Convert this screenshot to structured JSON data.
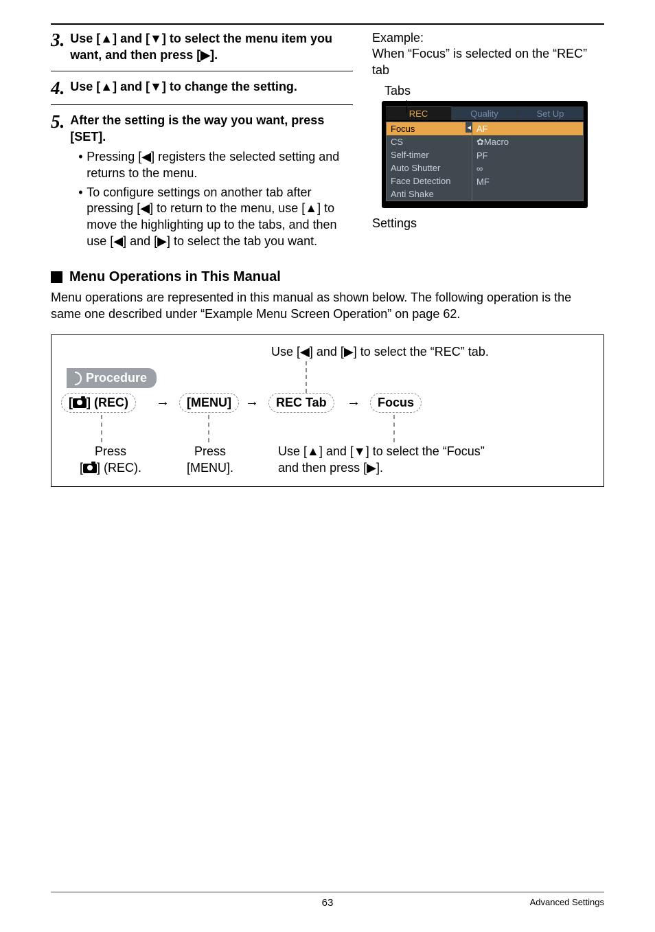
{
  "steps": {
    "s3": {
      "num": "3.",
      "text_a": "Use [",
      "text_b": "] and [",
      "text_c": "] to select the menu item you want, and then press [",
      "text_d": "]."
    },
    "s4": {
      "num": "4.",
      "text_a": "Use [",
      "text_b": "] and [",
      "text_c": "] to change the setting."
    },
    "s5": {
      "num": "5.",
      "heading": "After the setting is the way you want, press [SET].",
      "b1a": "Pressing [",
      "b1b": "] registers the selected setting and returns to the menu.",
      "b2a": "To configure settings on another tab after pressing [",
      "b2b": "] to return to the menu, use [",
      "b2c": "] to move the highlighting up to the tabs, and then use [",
      "b2d": "] and [",
      "b2e": "] to select the tab you want."
    }
  },
  "example": {
    "line1": "Example:",
    "line2": "When “Focus” is selected on the “REC” tab",
    "tabs_label": "Tabs",
    "settings_label": "Settings"
  },
  "menu": {
    "tabs": {
      "rec": "REC",
      "quality": "Quality",
      "setup": "Set Up"
    },
    "items": {
      "focus": "Focus",
      "cs": "CS",
      "selftimer": "Self-timer",
      "autoshutter": "Auto Shutter",
      "facedet": "Face Detection",
      "antishake": "Anti Shake"
    },
    "opts": {
      "af": "AF",
      "macro": "✿Macro",
      "pf": "PF",
      "inf": "∞",
      "mf": "MF"
    }
  },
  "section": {
    "title": "Menu Operations in This Manual",
    "body": "Menu operations are represented in this manual as shown below. The following operation is the same one described under “Example Menu Screen Operation” on page 62."
  },
  "diagram": {
    "top_label_a": "Use [",
    "top_label_b": "] and [",
    "top_label_c": "] to select the “REC” tab.",
    "procedure": "Procedure",
    "pill_rec_a": "[",
    "pill_rec_b": "] (REC)",
    "pill_menu": "[MENU]",
    "pill_rectab": "REC Tab",
    "pill_focus": "Focus",
    "lower_left_a": "Press",
    "lower_left_b_a": "[",
    "lower_left_b_b": "] (REC).",
    "lower_mid_a": "Press",
    "lower_mid_b": "[MENU].",
    "lower_right_a1": "Use [",
    "lower_right_a2": "] and [",
    "lower_right_a3": "] to select the “Focus”",
    "lower_right_b1": "and then press [",
    "lower_right_b2": "]."
  },
  "footer": {
    "page": "63",
    "section": "Advanced Settings"
  }
}
